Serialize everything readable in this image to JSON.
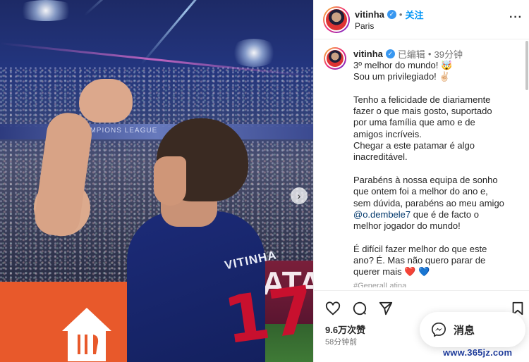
{
  "post": {
    "image": {
      "board_text": "QATAR",
      "league_text": "UEFA CHAMPIONS LEAGUE",
      "shirt_name": "VITINHA",
      "shirt_number": "17"
    },
    "header": {
      "username": "vitinha",
      "separator": "•",
      "follow_label": "关注",
      "location": "Paris",
      "more_icon": "more-horizontal-icon"
    },
    "caption": {
      "username": "vitinha",
      "edited_label": "已编辑",
      "separator": "•",
      "time": "39分钟",
      "lines": [
        "3º melhor do mundo! 🤯",
        "Sou um privilegiado! ✌🏻",
        "",
        "Tenho a felicidade de diariamente",
        "fazer o que mais gosto, suportado",
        "por uma família que amo e de",
        "amigos incríveis.",
        "Chegar a este patamar é algo",
        "inacreditável.",
        "",
        "Parabéns à nossa equipa de sonho",
        "que ontem foi a melhor do ano e,",
        "sem dúvida, parabéns ao meu amigo"
      ],
      "mention": "@o.dembele7",
      "mention_tail": " que é de facto o",
      "lines2": [
        "melhor jogador do mundo!",
        "",
        "É difícil fazer melhor do que este",
        "ano? É. Mas não quero parar de",
        "querer mais ❤️ 💙"
      ],
      "cut_line": "#GeneralLatina"
    },
    "actions": {
      "likes": "9.6万次赞",
      "ago": "58分钟前"
    },
    "message_button": {
      "label": "消息",
      "icon": "messenger-icon"
    },
    "watermark": "www.365jz.com"
  },
  "colors": {
    "verified": "#3897f0",
    "follow": "#0095f6",
    "mention": "#00376b"
  }
}
